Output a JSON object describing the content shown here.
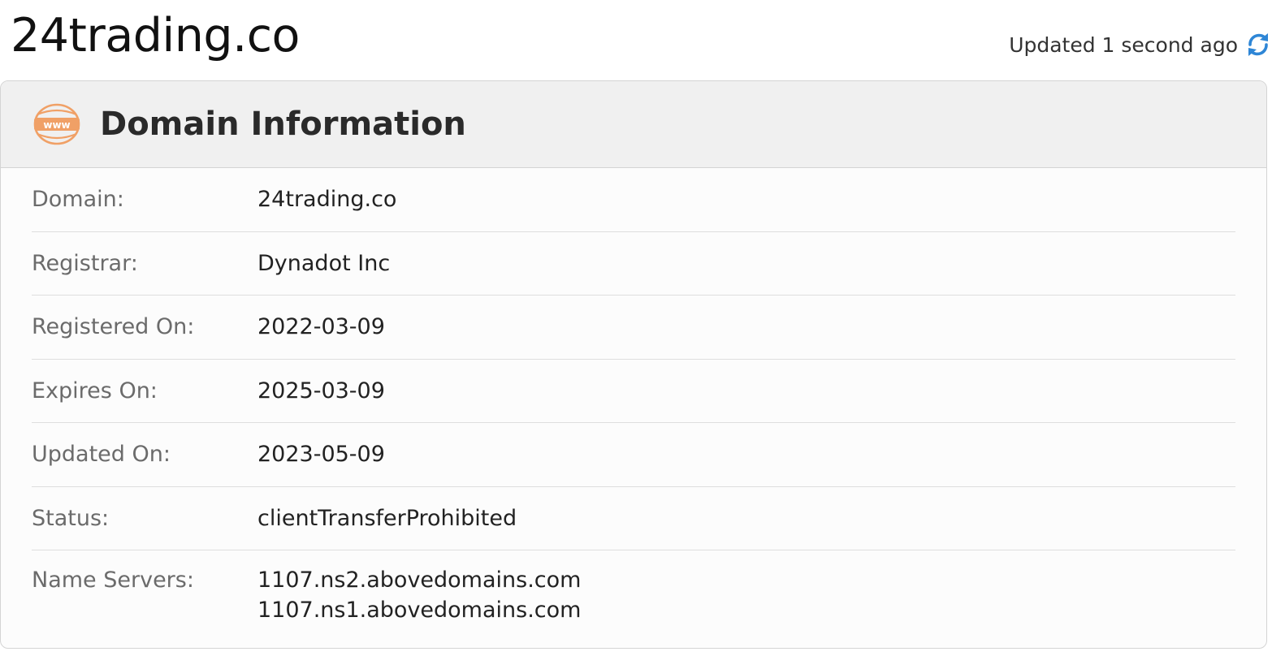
{
  "header": {
    "domain_title": "24trading.co",
    "updated_text": "Updated 1 second ago",
    "refresh_icon": "refresh-icon"
  },
  "card": {
    "title": "Domain Information",
    "icon": "www-icon",
    "icon_text": "www",
    "accent_color": "#f0a066",
    "refresh_color": "#2e86d6"
  },
  "rows": {
    "domain": {
      "label": "Domain:",
      "value": "24trading.co"
    },
    "registrar": {
      "label": "Registrar:",
      "value": "Dynadot Inc"
    },
    "registered": {
      "label": "Registered On:",
      "value": "2022-03-09"
    },
    "expires": {
      "label": "Expires On:",
      "value": "2025-03-09"
    },
    "updated": {
      "label": "Updated On:",
      "value": "2023-05-09"
    },
    "status": {
      "label": "Status:",
      "value": "clientTransferProhibited"
    },
    "name_servers": {
      "label": "Name Servers:",
      "values": [
        "1107.ns2.abovedomains.com",
        "1107.ns1.abovedomains.com"
      ]
    }
  }
}
